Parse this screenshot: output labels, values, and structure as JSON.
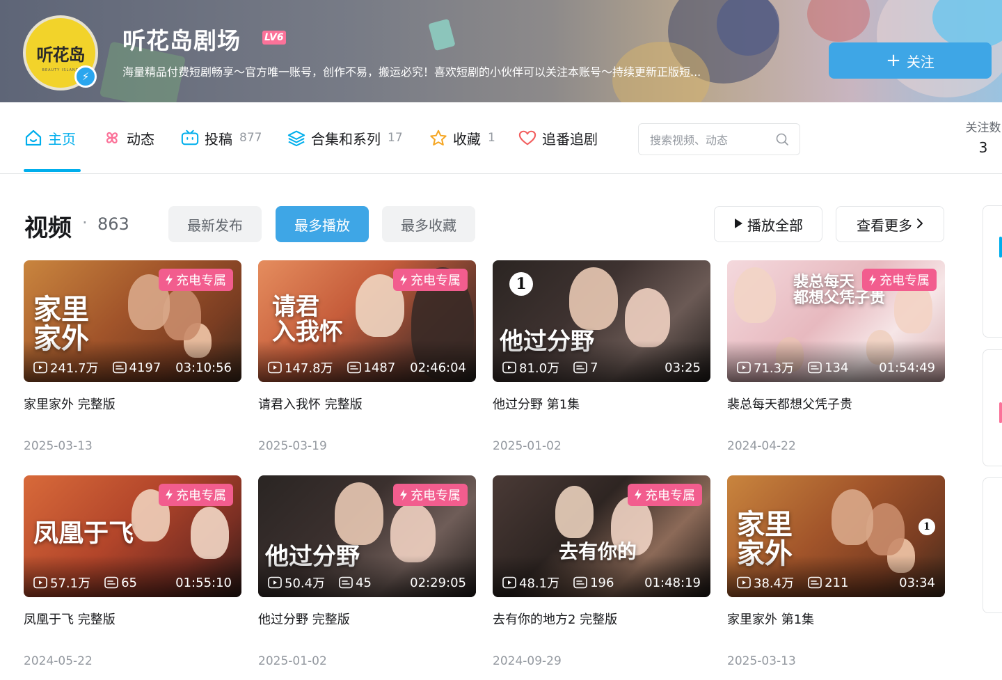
{
  "header": {
    "name": "听花岛剧场",
    "level": "LV6",
    "avatar_text": "听花岛",
    "avatar_subtext": "BEAUTY ISLAND",
    "sign": "海量精品付费短剧畅享～官方唯一账号，创作不易，搬运必究！喜欢短剧的小伙伴可以关注本账号～持续更新正版短...",
    "follow_label": "关注",
    "colors": {
      "follow": "#3ea6e6",
      "level": "#fb7299"
    }
  },
  "nav": {
    "items": [
      {
        "label": "主页",
        "count": "",
        "icon": "home-icon",
        "active": true
      },
      {
        "label": "动态",
        "count": "",
        "icon": "pinwheel-icon"
      },
      {
        "label": "投稿",
        "count": "877",
        "icon": "tv-icon"
      },
      {
        "label": "合集和系列",
        "count": "17",
        "icon": "layers-icon"
      },
      {
        "label": "收藏",
        "count": "1",
        "icon": "star-icon"
      },
      {
        "label": "追番追剧",
        "count": "",
        "icon": "heart-icon"
      }
    ],
    "search_placeholder": "搜索视频、动态",
    "stat_label": "关注数",
    "stat_value": "3",
    "accent": "#00aeec"
  },
  "videos_section": {
    "title": "视频",
    "dot": "·",
    "count": "863",
    "sort_tabs": [
      "最新发布",
      "最多播放",
      "最多收藏"
    ],
    "active_sort": "最多播放",
    "play_all": "播放全部",
    "see_more": "查看更多"
  },
  "videos": [
    {
      "title": "家里家外 完整版",
      "date": "2025-03-13",
      "plays": "241.7万",
      "danmaku": "4197",
      "duration": "03:10:56",
      "badge": "充电专属",
      "poster": "家里\n家外"
    },
    {
      "title": "请君入我怀 完整版",
      "date": "2025-03-19",
      "plays": "147.8万",
      "danmaku": "1487",
      "duration": "02:46:04",
      "badge": "充电专属",
      "poster": "请君\n入我怀"
    },
    {
      "title": "他过分野 第1集",
      "date": "2025-01-02",
      "plays": "81.0万",
      "danmaku": "7",
      "duration": "03:25",
      "badge": "",
      "episode": "1",
      "poster": "他过分野"
    },
    {
      "title": "裴总每天都想父凭子贵",
      "date": "2024-04-22",
      "plays": "71.3万",
      "danmaku": "134",
      "duration": "01:54:49",
      "badge": "充电专属",
      "poster": "裴总每天\n都想父凭子贵"
    },
    {
      "title": "凤凰于飞 完整版",
      "date": "2024-05-22",
      "plays": "57.1万",
      "danmaku": "65",
      "duration": "01:55:10",
      "badge": "充电专属",
      "poster": "凤凰于飞"
    },
    {
      "title": "他过分野 完整版",
      "date": "2025-01-02",
      "plays": "50.4万",
      "danmaku": "45",
      "duration": "02:29:05",
      "badge": "充电专属",
      "poster": "他过分野"
    },
    {
      "title": "去有你的地方2 完整版",
      "date": "2024-09-29",
      "plays": "48.1万",
      "danmaku": "196",
      "duration": "01:48:19",
      "badge": "充电专属",
      "poster": "去有你的"
    },
    {
      "title": "家里家外 第1集",
      "date": "2025-03-13",
      "plays": "38.4万",
      "danmaku": "211",
      "duration": "03:34",
      "badge": "",
      "episode": "1",
      "poster": "家里\n家外"
    }
  ]
}
